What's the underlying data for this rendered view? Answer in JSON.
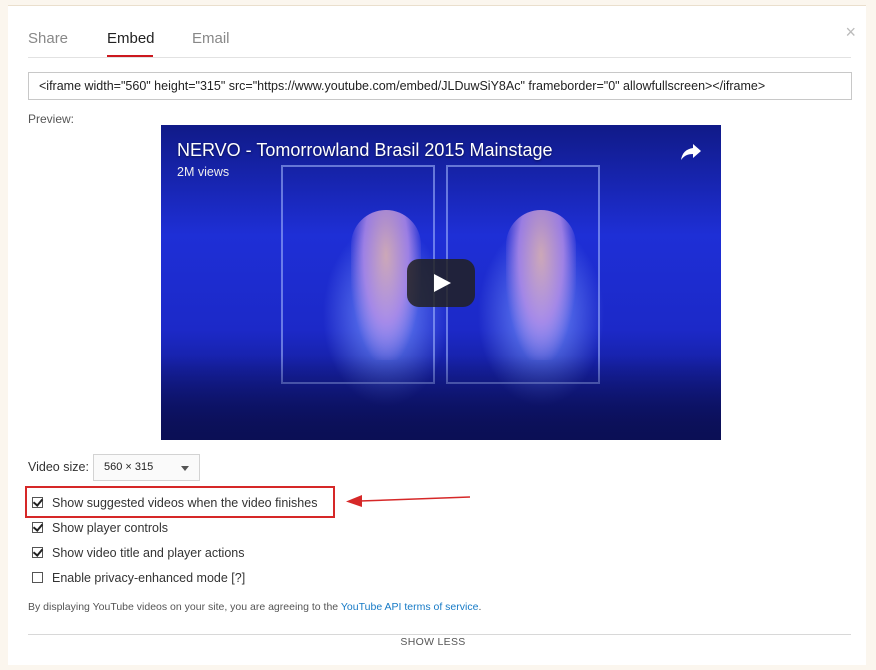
{
  "tabs": [
    {
      "label": "Share",
      "active": false
    },
    {
      "label": "Embed",
      "active": true
    },
    {
      "label": "Email",
      "active": false
    }
  ],
  "close_glyph": "×",
  "embed_code": "<iframe width=\"560\" height=\"315\" src=\"https://www.youtube.com/embed/JLDuwSiY8Ac\" frameborder=\"0\" allowfullscreen></iframe>",
  "preview_label": "Preview:",
  "video": {
    "title": "NERVO - Tomorrowland Brasil 2015 Mainstage",
    "views": "2M views"
  },
  "video_size": {
    "label": "Video size:",
    "selected": "560 × 315"
  },
  "options": [
    {
      "label": "Show suggested videos when the video finishes",
      "checked": true
    },
    {
      "label": "Show player controls",
      "checked": true
    },
    {
      "label": "Show video title and player actions",
      "checked": true
    },
    {
      "label": "Enable privacy-enhanced mode",
      "checked": false,
      "help": "[?]"
    }
  ],
  "tos": {
    "prefix": "By displaying YouTube videos on your site, you are agreeing to the ",
    "link": "YouTube API terms of service",
    "suffix": "."
  },
  "show_less": "SHOW LESS",
  "colors": {
    "accent": "#cc181e",
    "annotation": "#d62828",
    "link": "#167ac6"
  }
}
